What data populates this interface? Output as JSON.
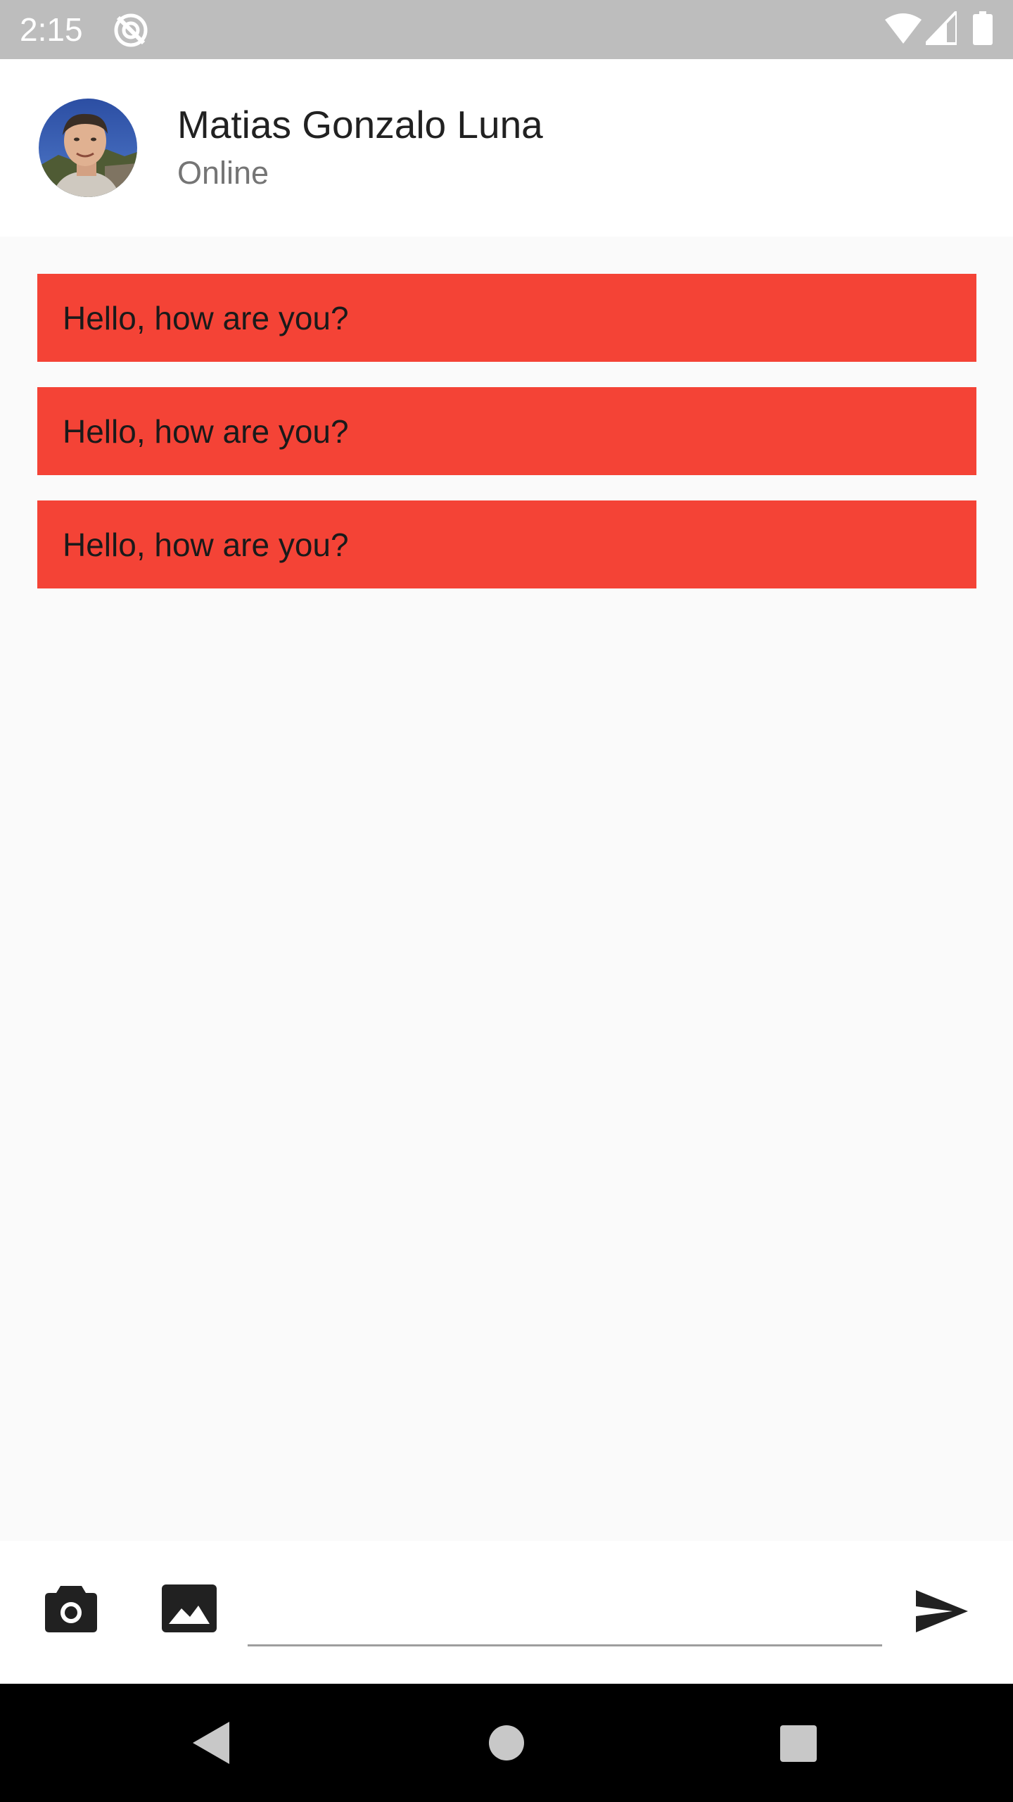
{
  "status_bar": {
    "time": "2:15",
    "icons": [
      "sync-disabled-icon",
      "wifi-icon",
      "signal-icon",
      "battery-icon"
    ]
  },
  "header": {
    "contact_name": "Matias Gonzalo Luna",
    "contact_status": "Online",
    "avatar": "profile-photo"
  },
  "messages": [
    {
      "text": "Hello, how are you?"
    },
    {
      "text": "Hello, how are you?"
    },
    {
      "text": "Hello, how are you?"
    }
  ],
  "input_bar": {
    "message_value": "",
    "message_placeholder": "",
    "icons": [
      "camera-icon",
      "image-icon",
      "send-icon"
    ]
  },
  "nav_bar": {
    "icons": [
      "back-icon",
      "home-icon",
      "recents-icon"
    ]
  },
  "colors": {
    "status_bar": "#bdbdbd",
    "bubble": "#f44336",
    "background": "#fafafa",
    "nav_bar": "#000000"
  }
}
